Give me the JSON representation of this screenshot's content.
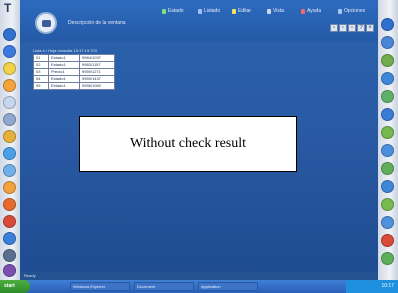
{
  "header": {
    "subtitle": "Descripción de la ventana"
  },
  "menu": [
    {
      "label": "Estado",
      "color": "#7ee07a"
    },
    {
      "label": "Listado",
      "color": "#9fc2f0"
    },
    {
      "label": "Editar",
      "color": "#f3e35a"
    },
    {
      "label": "Vista",
      "color": "#cfd8e6"
    },
    {
      "label": "Ayuda",
      "color": "#f06a6a"
    },
    {
      "label": "Opciones",
      "color": "#a9c6ef"
    }
  ],
  "window_buttons": [
    "▫",
    "▫",
    "▫",
    "?",
    "×"
  ],
  "table": {
    "caption": "Lista 4 / Hoja consulta 10:17:13.703",
    "rows": [
      [
        "01",
        "Estado1",
        "9984/1037"
      ],
      [
        "02",
        "Estado1",
        "9983/1157"
      ],
      [
        "03",
        "Precio1",
        "9959/1271"
      ],
      [
        "04",
        "Estado1",
        "9959/1437"
      ],
      [
        "05",
        "Estado1",
        "9956/1060"
      ]
    ]
  },
  "note": {
    "text": "Without check result"
  },
  "status": {
    "text": "Ready"
  },
  "taskbar": {
    "start_label": "start",
    "items": [
      "Windows Explorer",
      "Document",
      "Application"
    ],
    "clock": "10:17"
  }
}
